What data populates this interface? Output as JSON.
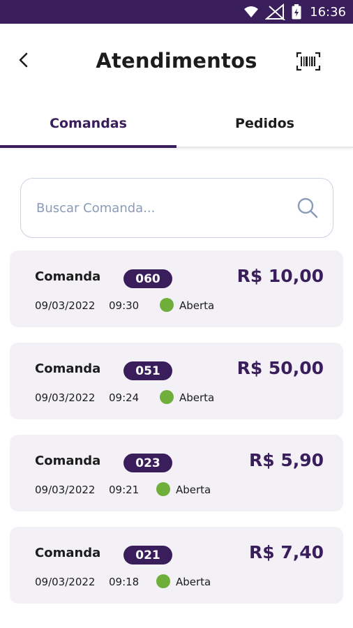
{
  "status_bar": {
    "time": "16:36"
  },
  "header": {
    "title": "Atendimentos",
    "back_icon": "chevron-left-icon",
    "barcode_icon": "barcode-icon"
  },
  "tabs": [
    {
      "label": "Comandas",
      "active": true
    },
    {
      "label": "Pedidos",
      "active": false
    }
  ],
  "search": {
    "placeholder": "Buscar Comanda...",
    "value": "",
    "icon": "search-icon"
  },
  "comandas": [
    {
      "label": "Comanda",
      "number": "060",
      "amount": "R$ 10,00",
      "date": "09/03/2022",
      "time": "09:30",
      "status": "Aberta"
    },
    {
      "label": "Comanda",
      "number": "051",
      "amount": "R$ 50,00",
      "date": "09/03/2022",
      "time": "09:24",
      "status": "Aberta"
    },
    {
      "label": "Comanda",
      "number": "023",
      "amount": "R$ 5,90",
      "date": "09/03/2022",
      "time": "09:21",
      "status": "Aberta"
    },
    {
      "label": "Comanda",
      "number": "021",
      "amount": "R$ 7,40",
      "date": "09/03/2022",
      "time": "09:18",
      "status": "Aberta"
    }
  ],
  "colors": {
    "primary": "#3a1d5b",
    "status_open": "#6fae3b",
    "card_bg": "#f3f1f6"
  }
}
